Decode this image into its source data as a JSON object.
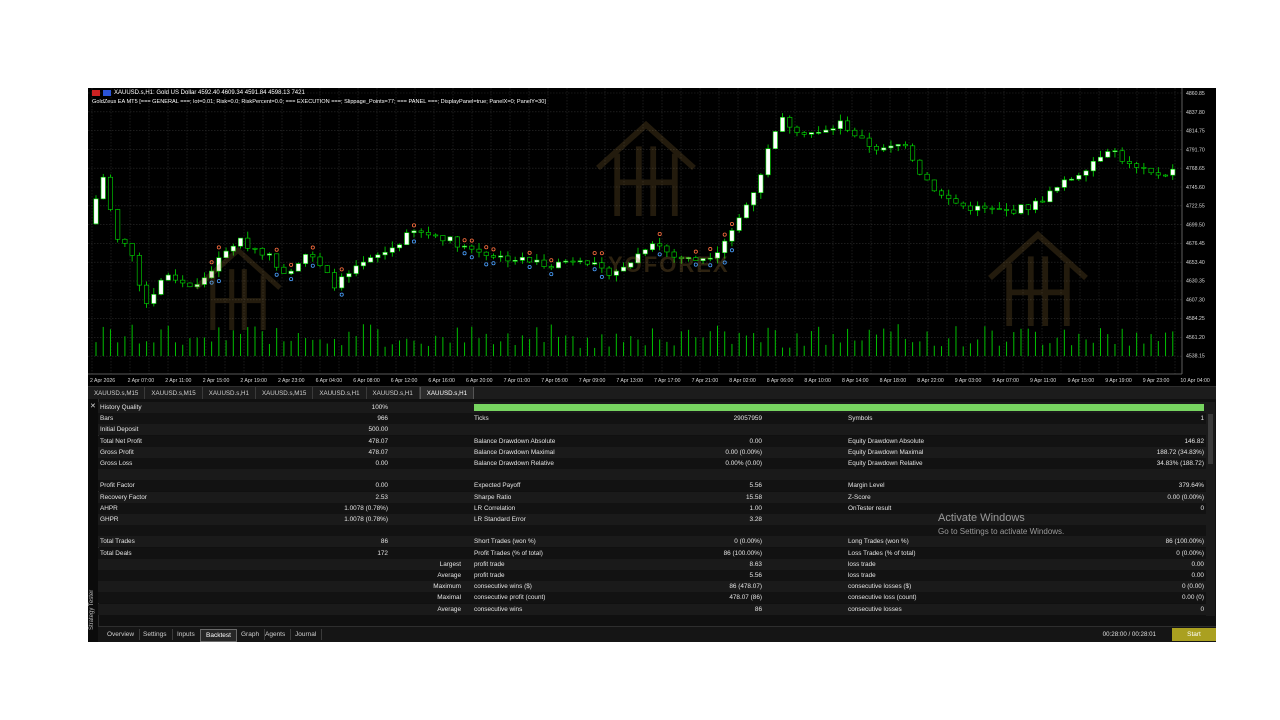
{
  "chart": {
    "title": "XAUUSD.s,H1: Gold US Dollar  4592.40 4609.34 4591.84 4598.13  7421",
    "params": "GoldZeus EA MT5 [=== GENERAL ===; lot=0.01; Risk=0.0; RiskPercent=0.0; === EXECUTION ===; Slippage_Points=77; === PANEL ===; DisplayPanel=true; PanelX=0; PanelY=30]",
    "logo_text": "YOFOREX",
    "y_axis": [
      "4860.85",
      "4837.80",
      "4814.75",
      "4791.70",
      "4768.65",
      "4745.60",
      "4722.55",
      "4699.50",
      "4676.45",
      "4653.40",
      "4630.35",
      "4607.30",
      "4584.25",
      "4561.20",
      "4538.15"
    ],
    "x_axis": [
      "2 Apr 2026",
      "2 Apr 07:00",
      "2 Apr 11:00",
      "2 Apr 15:00",
      "2 Apr 19:00",
      "2 Apr 23:00",
      "6 Apr 04:00",
      "6 Apr 08:00",
      "6 Apr 12:00",
      "6 Apr 16:00",
      "6 Apr 20:00",
      "7 Apr 01:00",
      "7 Apr 05:00",
      "7 Apr 09:00",
      "7 Apr 13:00",
      "7 Apr 17:00",
      "7 Apr 21:00",
      "8 Apr 02:00",
      "8 Apr 06:00",
      "8 Apr 10:00",
      "8 Apr 14:00",
      "8 Apr 18:00",
      "8 Apr 22:00",
      "9 Apr 03:00",
      "9 Apr 07:00",
      "9 Apr 11:00",
      "9 Apr 15:00",
      "9 Apr 19:00",
      "9 Apr 23:00",
      "10 Apr 04:00"
    ],
    "colors": {
      "bull": "#ffffff",
      "bear": "#00e000",
      "wick": "#00e000",
      "grid": "#2c2c2c",
      "volume": "#00c000",
      "buy_marker": "#4aa0ff",
      "sell_marker": "#ff7040"
    }
  },
  "chart_tabs": [
    "XAUUSD.s,M15",
    "XAUUSD.s,M15",
    "XAUUSD.s,H1",
    "XAUUSD.s,M15",
    "XAUUSD.s,H1",
    "XAUUSD.s,H1",
    "XAUUSD.s,H1"
  ],
  "active_chart_tab": 6,
  "results": [
    [
      "History Quality",
      "100%",
      "",
      "",
      "",
      ""
    ],
    [
      "Bars",
      "966",
      "Ticks",
      "29057959",
      "Symbols",
      "1"
    ],
    [
      "Initial Deposit",
      "500.00",
      "",
      "",
      "",
      ""
    ],
    [
      "Total Net Profit",
      "478.07",
      "Balance Drawdown Absolute",
      "0.00",
      "Equity Drawdown Absolute",
      "146.82"
    ],
    [
      "Gross Profit",
      "478.07",
      "Balance Drawdown Maximal",
      "0.00 (0.00%)",
      "Equity Drawdown Maximal",
      "188.72 (34.83%)"
    ],
    [
      "Gross Loss",
      "0.00",
      "Balance Drawdown Relative",
      "0.00% (0.00)",
      "Equity Drawdown Relative",
      "34.83% (188.72)"
    ],
    [
      "",
      "",
      "",
      "",
      "",
      ""
    ],
    [
      "Profit Factor",
      "0.00",
      "Expected Payoff",
      "5.56",
      "Margin Level",
      "379.64%"
    ],
    [
      "Recovery Factor",
      "2.53",
      "Sharpe Ratio",
      "15.58",
      "Z-Score",
      "0.00 (0.00%)"
    ],
    [
      "AHPR",
      "1.0078 (0.78%)",
      "LR Correlation",
      "1.00",
      "OnTester result",
      "0"
    ],
    [
      "GHPR",
      "1.0078 (0.78%)",
      "LR Standard Error",
      "3.28",
      "",
      ""
    ],
    [
      "",
      "",
      "",
      "",
      "",
      ""
    ],
    [
      "Total Trades",
      "86",
      "Short Trades (won %)",
      "0 (0.00%)",
      "Long Trades (won %)",
      "86 (100.00%)"
    ],
    [
      "Total Deals",
      "172",
      "Profit Trades (% of total)",
      "86 (100.00%)",
      "Loss Trades (% of total)",
      "0 (0.00%)"
    ],
    [
      "",
      "Largest",
      "profit trade",
      "8.63",
      "loss trade",
      "0.00"
    ],
    [
      "",
      "Average",
      "profit trade",
      "5.56",
      "loss trade",
      "0.00"
    ],
    [
      "",
      "Maximum",
      "consecutive wins ($)",
      "86 (478.07)",
      "consecutive losses ($)",
      "0 (0.00)"
    ],
    [
      "",
      "Maximal",
      "consecutive profit (count)",
      "478.07 (86)",
      "consecutive loss (count)",
      "0.00 (0)"
    ],
    [
      "",
      "Average",
      "consecutive wins",
      "86",
      "consecutive losses",
      "0"
    ]
  ],
  "history_quality_fill": 1.0,
  "bottom_tabs": [
    "Overview",
    "Settings",
    "Inputs",
    "Backtest",
    "Graph",
    "Agents",
    "Journal"
  ],
  "active_bottom_tab": 3,
  "timer": "00:28:00 / 00:28:01",
  "start_label": "Start",
  "side_label": "Strategy Tester",
  "close_symbol": "✕",
  "watermark": {
    "title": "Activate Windows",
    "subtitle": "Go to Settings to activate Windows."
  }
}
